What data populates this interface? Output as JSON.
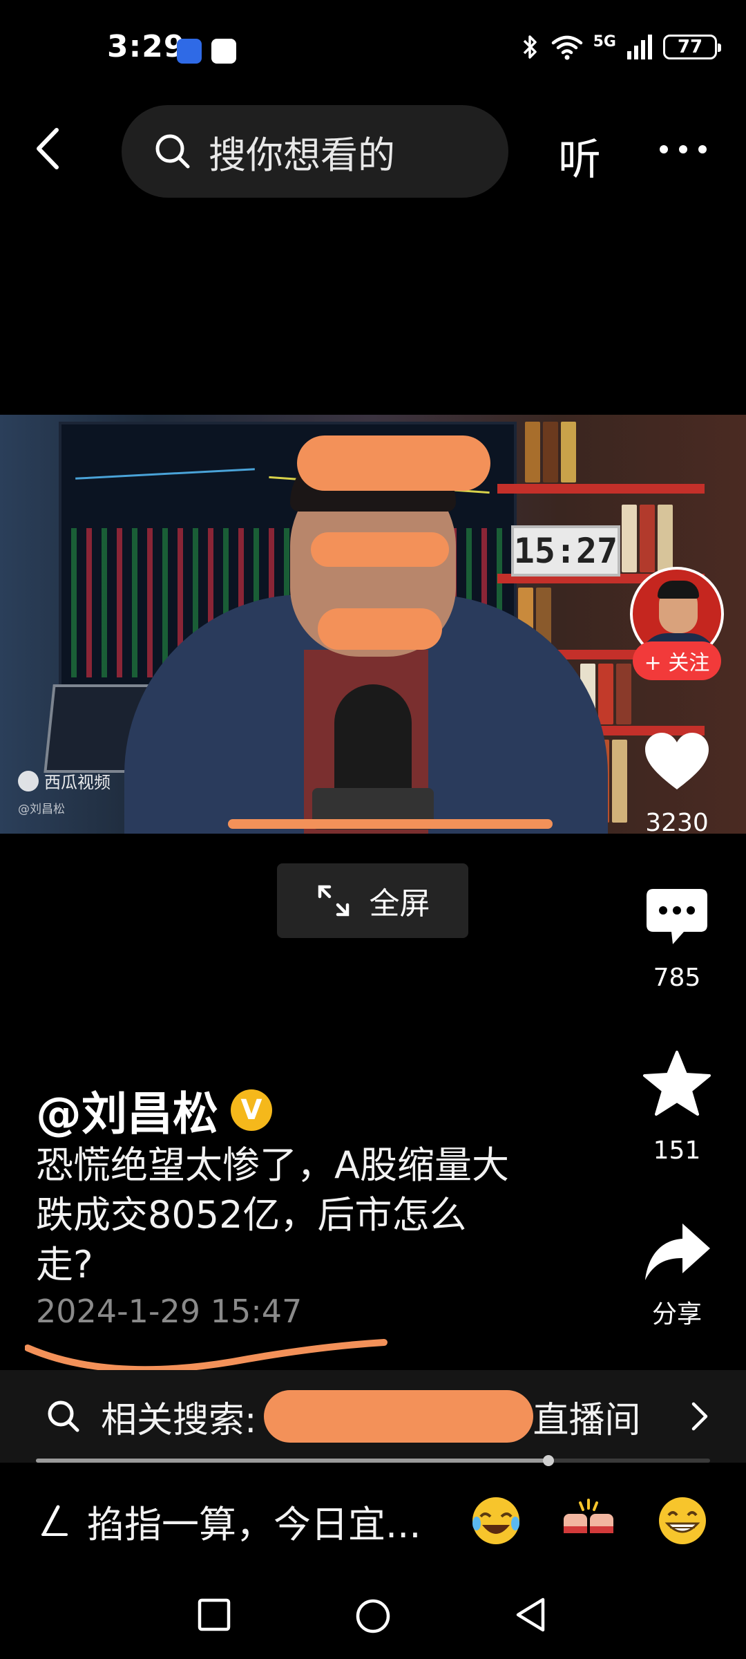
{
  "status_bar": {
    "time": "3:29",
    "network": "5G",
    "battery": "77"
  },
  "search": {
    "placeholder": "搜你想看的",
    "listen_label": "听"
  },
  "video": {
    "watermark": "西瓜视频",
    "watermark_sub": "@刘昌松",
    "clock_text": "15:27"
  },
  "actions": {
    "follow_label": "+ 关注",
    "like_count": "3230",
    "comment_count": "785",
    "favorite_count": "151",
    "share_label": "分享"
  },
  "fullscreen_label": "全屏",
  "post": {
    "author": "@刘昌松",
    "verified_mark": "V",
    "caption_line1": "恐慌绝望太惨了，A股缩量大",
    "caption_line2": "跌成交8052亿，后市怎么",
    "caption_line3": "走?",
    "date": "2024-1-29 15:47"
  },
  "related_search": {
    "label": "相关搜索:",
    "suffix": "直播间"
  },
  "playback_progress": 0.76,
  "comment": {
    "placeholder": "掐指一算，今日宜..."
  },
  "colors": {
    "accent_red": "#f23a3a",
    "verified_gold": "#f5b81b",
    "scribble_orange": "#f39159"
  }
}
